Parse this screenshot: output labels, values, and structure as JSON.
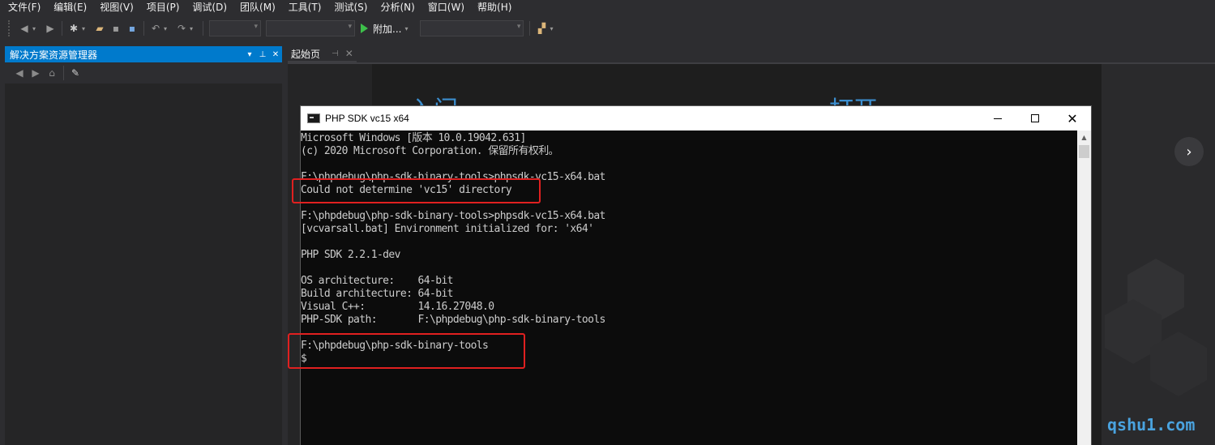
{
  "menu": [
    "文件(F)",
    "编辑(E)",
    "视图(V)",
    "项目(P)",
    "调试(D)",
    "团队(M)",
    "工具(T)",
    "测试(S)",
    "分析(N)",
    "窗口(W)",
    "帮助(H)"
  ],
  "toolbar": {
    "attach_label": "附加..."
  },
  "solution_explorer": {
    "title": "解决方案资源管理器",
    "pin": "▾ ⊥ ✕"
  },
  "doc_tab": {
    "label": "起始页",
    "pin": "⊣",
    "close": "✕"
  },
  "start_page": {
    "heading_left": "入门",
    "heading_right": "打开"
  },
  "console": {
    "title": "PHP SDK vc15 x64",
    "lines": [
      "Microsoft Windows [版本 10.0.19042.631]",
      "(c) 2020 Microsoft Corporation. 保留所有权利。",
      "",
      "F:\\phpdebug\\php-sdk-binary-tools>phpsdk-vc15-x64.bat",
      "Could not determine 'vc15' directory",
      "",
      "F:\\phpdebug\\php-sdk-binary-tools>phpsdk-vc15-x64.bat",
      "[vcvarsall.bat] Environment initialized for: 'x64'",
      "",
      "PHP SDK 2.2.1-dev",
      "",
      "OS architecture:    64-bit",
      "Build architecture: 64-bit",
      "Visual C++:         14.16.27048.0",
      "PHP-SDK path:       F:\\phpdebug\\php-sdk-binary-tools",
      "",
      "F:\\phpdebug\\php-sdk-binary-tools",
      "$"
    ]
  },
  "watermark": "qshu1.com",
  "colors": {
    "accent": "#007acc",
    "highlight": "#e02020",
    "console_bg": "#0c0c0c",
    "console_text": "#cccccc"
  },
  "icons": [
    "back-icon",
    "forward-icon",
    "new-project-icon",
    "open-icon",
    "save-icon",
    "save-all-icon",
    "undo-icon",
    "redo-icon",
    "start-icon",
    "find-icon",
    "home-icon",
    "wrench-icon",
    "next-arrow-icon",
    "close-icon",
    "maximize-icon",
    "minimize-icon"
  ]
}
